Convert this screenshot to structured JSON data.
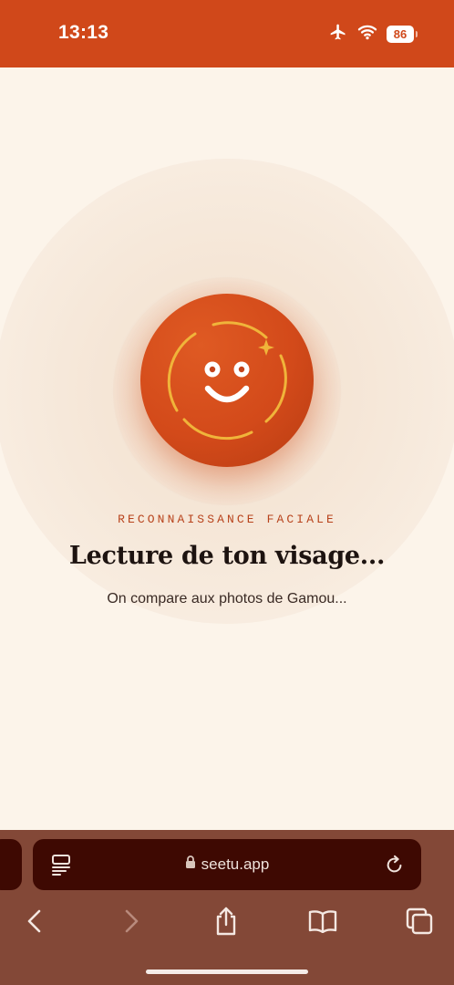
{
  "status_bar": {
    "time": "13:13",
    "battery": "86",
    "icons": [
      "airplane-icon",
      "wifi-icon",
      "battery-icon"
    ],
    "background": "#d0481a"
  },
  "main": {
    "label": "RECONNAISSANCE FACIALE",
    "title": "Lecture de ton visage...",
    "subtitle": "On compare aux photos de Gamou...",
    "illustration": "smiley-face-scan-icon",
    "accent": "#d34a1a",
    "ring_color": "#f0b43a"
  },
  "browser": {
    "url": "seetu.app",
    "icons": [
      "tabs-menu-icon",
      "lock-icon",
      "reload-icon"
    ],
    "toolbar": [
      "back-icon",
      "forward-icon",
      "share-icon",
      "bookmarks-icon",
      "tabs-icon"
    ]
  }
}
